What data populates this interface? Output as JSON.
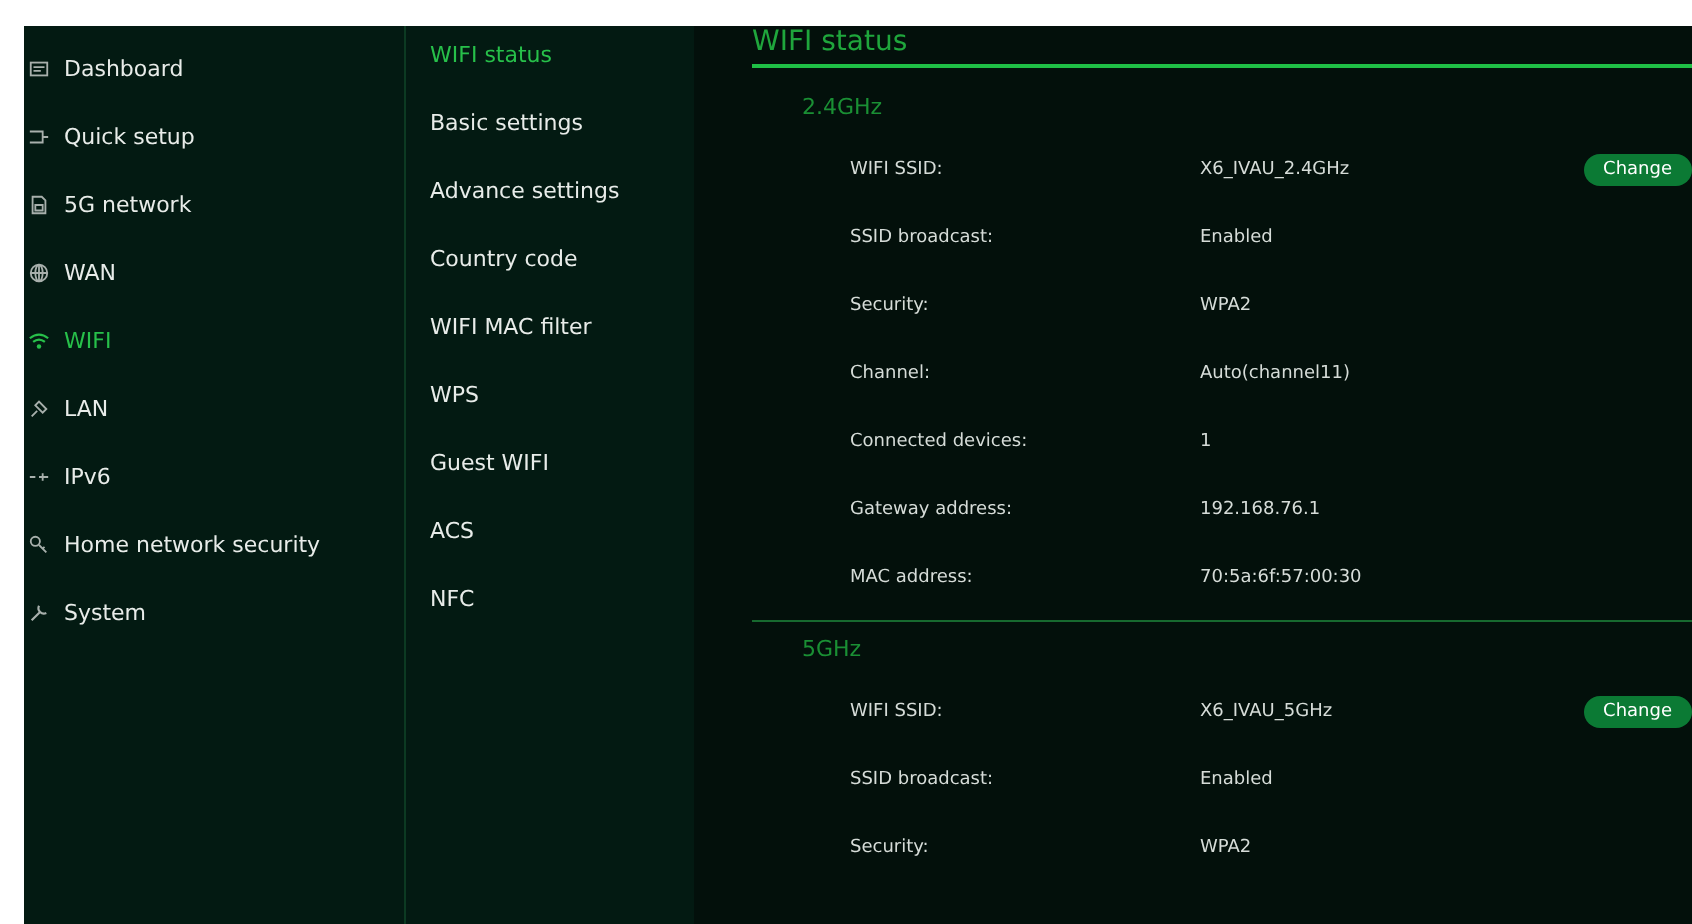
{
  "sidebar": {
    "items": [
      {
        "label": "Dashboard",
        "selected": false
      },
      {
        "label": "Quick setup",
        "selected": false
      },
      {
        "label": "5G network",
        "selected": false
      },
      {
        "label": "WAN",
        "selected": false
      },
      {
        "label": "WIFI",
        "selected": true
      },
      {
        "label": "LAN",
        "selected": false
      },
      {
        "label": "IPv6",
        "selected": false
      },
      {
        "label": "Home network security",
        "selected": false
      },
      {
        "label": "System",
        "selected": false
      }
    ]
  },
  "submenu": {
    "items": [
      {
        "label": "WIFI status",
        "selected": true
      },
      {
        "label": "Basic settings",
        "selected": false
      },
      {
        "label": "Advance settings",
        "selected": false
      },
      {
        "label": "Country code",
        "selected": false
      },
      {
        "label": "WIFI MAC filter",
        "selected": false
      },
      {
        "label": "WPS",
        "selected": false
      },
      {
        "label": "Guest WIFI",
        "selected": false
      },
      {
        "label": "ACS",
        "selected": false
      },
      {
        "label": "NFC",
        "selected": false
      }
    ]
  },
  "content": {
    "title": "WIFI status",
    "sections": [
      {
        "heading": "2.4GHz",
        "rows": [
          {
            "label": "WIFI SSID:",
            "value": "X6_IVAU_2.4GHz",
            "button": "Change"
          },
          {
            "label": "SSID broadcast:",
            "value": "Enabled"
          },
          {
            "label": "Security:",
            "value": "WPA2"
          },
          {
            "label": "Channel:",
            "value": "Auto(channel11)"
          },
          {
            "label": "Connected devices:",
            "value": "1"
          },
          {
            "label": "Gateway address:",
            "value": "192.168.76.1"
          },
          {
            "label": "MAC address:",
            "value": "70:5a:6f:57:00:30"
          }
        ]
      },
      {
        "heading": "5GHz",
        "rows": [
          {
            "label": "WIFI SSID:",
            "value": "X6_IVAU_5GHz",
            "button": "Change"
          },
          {
            "label": "SSID broadcast:",
            "value": "Enabled"
          },
          {
            "label": "Security:",
            "value": "WPA2"
          }
        ]
      }
    ]
  }
}
